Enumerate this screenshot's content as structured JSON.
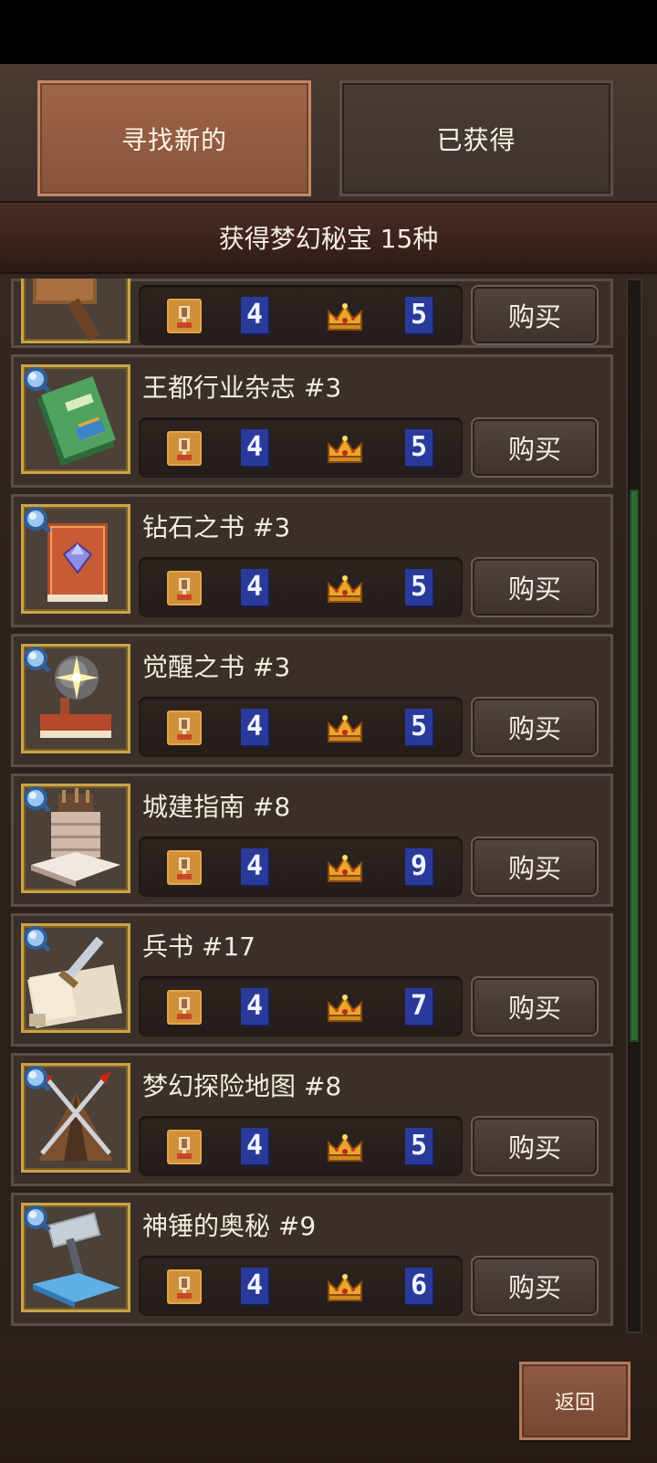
{
  "tabs": {
    "find_new": "寻找新的",
    "owned": "已获得"
  },
  "summary": {
    "text": "获得梦幻秘宝 15种"
  },
  "buy_label": "购买",
  "back_label": "返回",
  "icons": {
    "lens": "magnifier-icon",
    "trophy": "trophy-icon",
    "crown": "crown-icon"
  },
  "colors": {
    "tab_active": "#a0664a",
    "tab_inactive": "#4a3d37",
    "thumb_border_gold": "#c9a44a",
    "number_badge_blue": "#2a3a9a",
    "scrollbar_green": "#2d6a33"
  },
  "scroll_position": 0.42,
  "items": [
    {
      "name": "",
      "icon": "hammer-icon",
      "stat_a": "4",
      "stat_b": "5",
      "partial": true
    },
    {
      "name": "王都行业杂志 #3",
      "icon": "magazine-icon",
      "stat_a": "4",
      "stat_b": "5"
    },
    {
      "name": "钻石之书 #3",
      "icon": "diamond-book-icon",
      "stat_a": "4",
      "stat_b": "5"
    },
    {
      "name": "觉醒之书 #3",
      "icon": "awakening-book-icon",
      "stat_a": "4",
      "stat_b": "5"
    },
    {
      "name": "城建指南 #8",
      "icon": "city-guide-icon",
      "stat_a": "4",
      "stat_b": "9"
    },
    {
      "name": "兵书 #17",
      "icon": "war-scroll-icon",
      "stat_a": "4",
      "stat_b": "7"
    },
    {
      "name": "梦幻探险地图 #8",
      "icon": "adventure-tent-icon",
      "stat_a": "4",
      "stat_b": "5"
    },
    {
      "name": "神锤的奥秘 #9",
      "icon": "divine-hammer-icon",
      "stat_a": "4",
      "stat_b": "6"
    }
  ]
}
